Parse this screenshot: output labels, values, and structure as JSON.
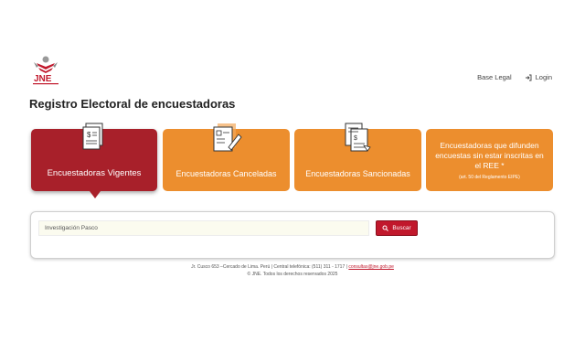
{
  "header": {
    "logo_text": "JNE",
    "nav": {
      "base_legal": "Base Legal",
      "login": "Login"
    }
  },
  "page": {
    "title": "Registro Electoral de encuestadoras"
  },
  "cards": [
    {
      "label": "Encuestadoras Vigentes"
    },
    {
      "label": "Encuestadoras Canceladas"
    },
    {
      "label": "Encuestadoras Sancionadas"
    },
    {
      "label": "Encuestadoras que difunden encuestas sin estar inscritas en el REE *",
      "note": "(art. 50 del Reglamento EIPE)"
    }
  ],
  "search": {
    "value": "Investigación Pasco",
    "button_label": "Buscar"
  },
  "footer": {
    "line1_prefix": "Jr. Cusco 653 –Cercado de Lima. Perú | Central telefónica: (511) 311 - 1717 |",
    "email": "consultas@jne.gob.pe",
    "line2": "© JNE. Todos los derechos reservados 2025"
  },
  "colors": {
    "primary_red": "#a8202a",
    "orange": "#ec8e2e",
    "button_red": "#c1182c"
  }
}
